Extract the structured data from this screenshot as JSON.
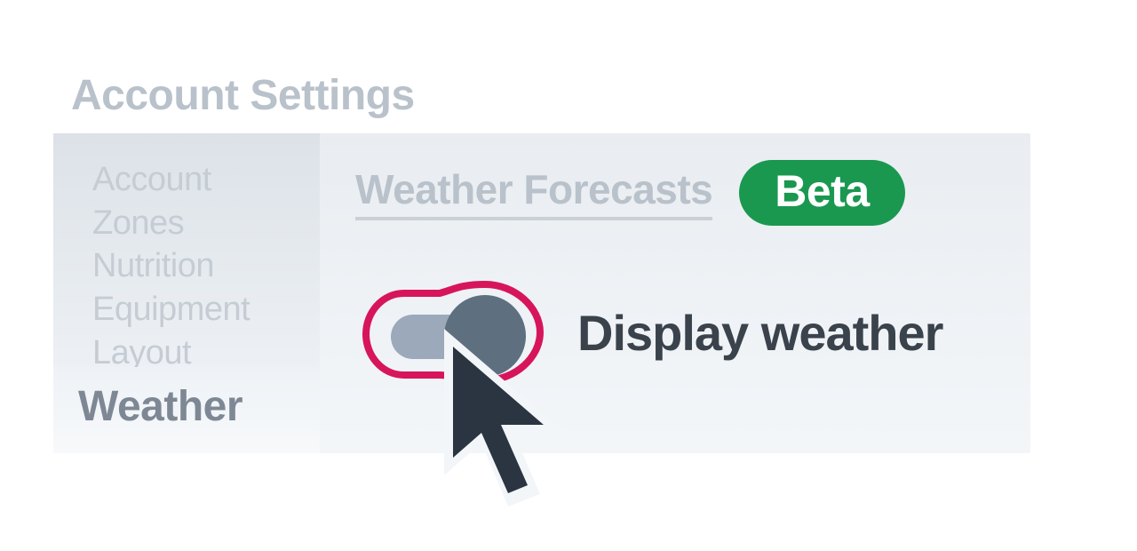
{
  "page_title": "Account Settings",
  "sidebar": {
    "items": [
      {
        "label": "Account",
        "active": false
      },
      {
        "label": "Zones",
        "active": false
      },
      {
        "label": "Nutrition",
        "active": false
      },
      {
        "label": "Equipment",
        "active": false
      },
      {
        "label": "Layout",
        "active": false
      },
      {
        "label": "Weather",
        "active": true
      }
    ]
  },
  "section": {
    "title": "Weather Forecasts",
    "badge": "Beta"
  },
  "toggle": {
    "label": "Display weather",
    "state": "on",
    "focused": true
  },
  "colors": {
    "badge_bg": "#1A9850",
    "focus_ring": "#D7155B",
    "knob": "#5E6F80",
    "track": "#9BA9BA",
    "cursor_fill": "#2B3541"
  }
}
